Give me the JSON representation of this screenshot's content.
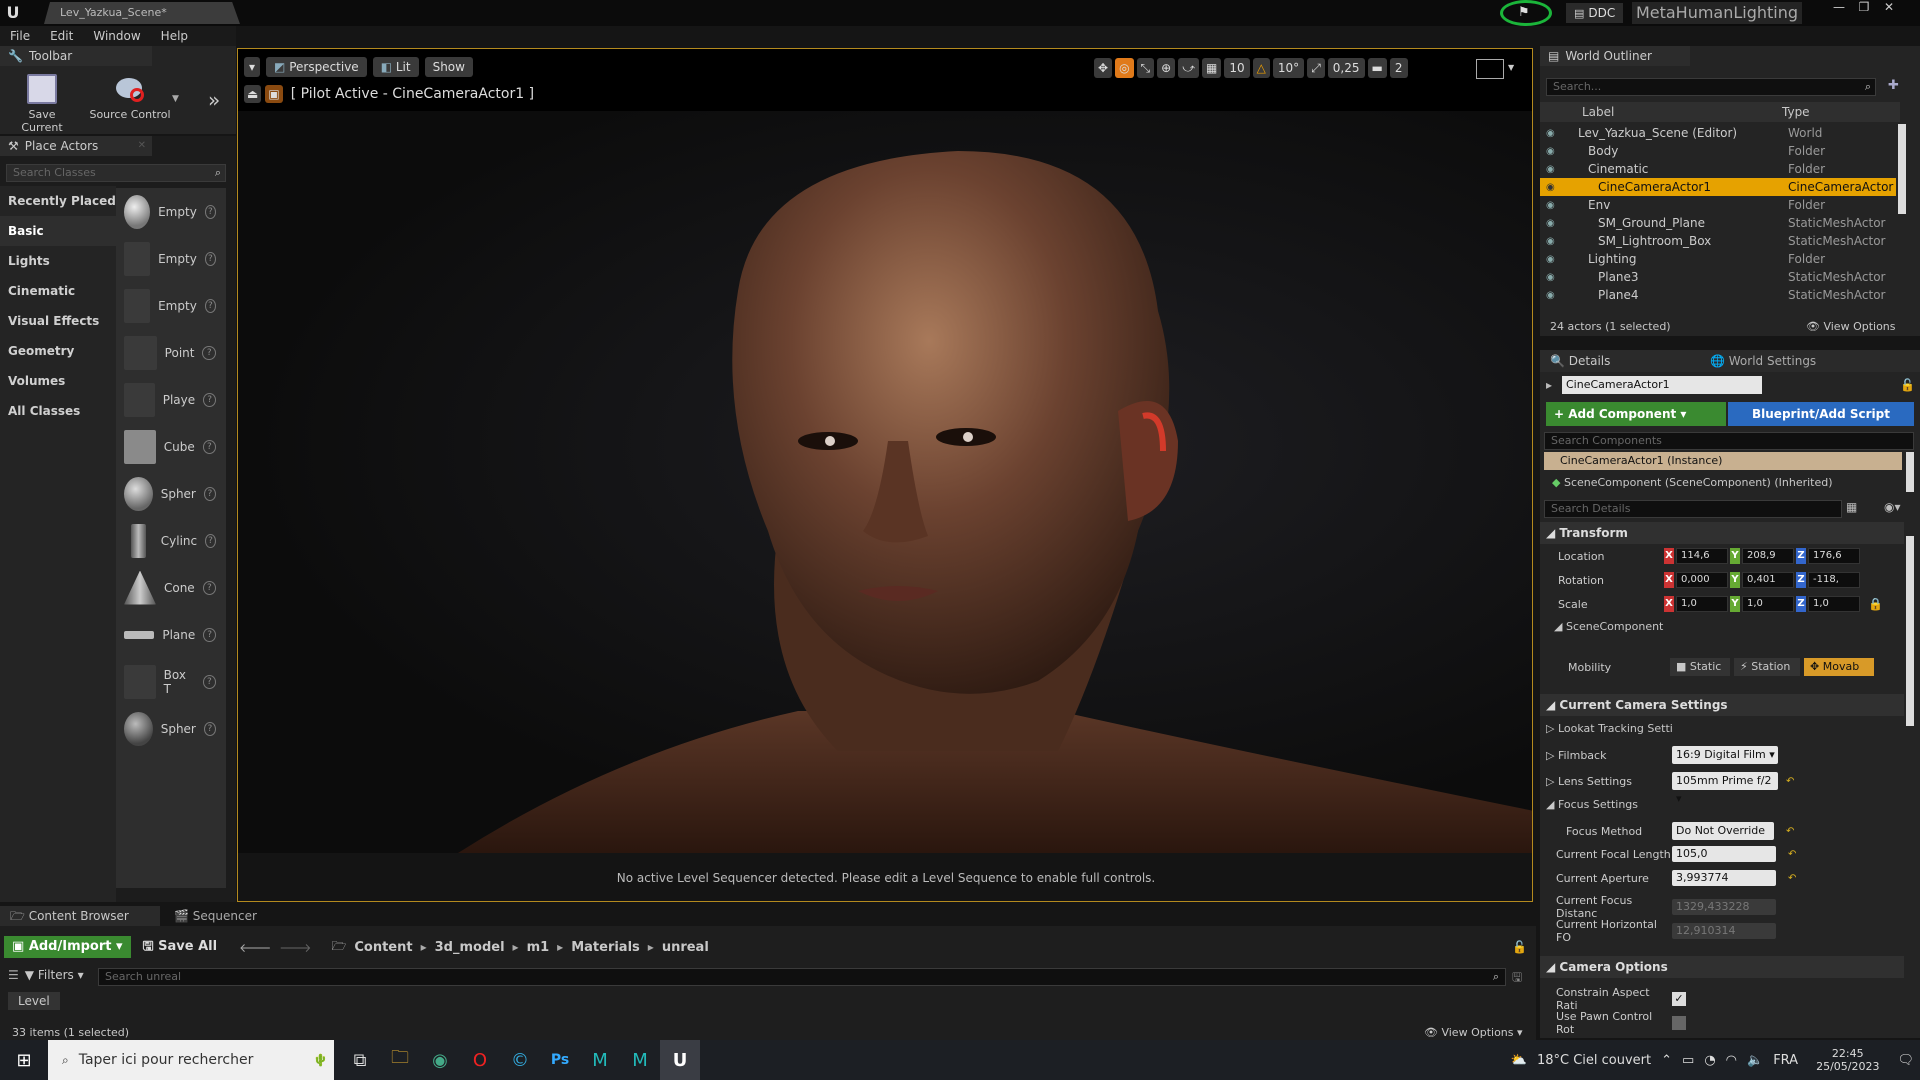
{
  "window": {
    "tab_title": "Lev_Yazkua_Scene*",
    "ddc": "DDC",
    "project": "MetaHumanLighting"
  },
  "menu": [
    "File",
    "Edit",
    "Window",
    "Help"
  ],
  "toolbar": {
    "title": "Toolbar",
    "save_current": "Save Current",
    "source_control": "Source Control"
  },
  "place_actors": {
    "title": "Place Actors",
    "search_placeholder": "Search Classes",
    "categories": [
      "Recently Placed",
      "Basic",
      "Lights",
      "Cinematic",
      "Visual Effects",
      "Geometry",
      "Volumes",
      "All Classes"
    ],
    "items": [
      "Empty",
      "Empty",
      "Empty",
      "Point",
      "Playe",
      "Cube",
      "Spher",
      "Cylinc",
      "Cone",
      "Plane",
      "Box T",
      "Spher"
    ]
  },
  "viewport": {
    "perspective": "Perspective",
    "lit": "Lit",
    "show": "Show",
    "pilot": "[ Pilot Active - CineCameraActor1 ]",
    "grid_snap": "10",
    "rot_snap": "10°",
    "scale_snap": "0,25",
    "cam_speed": "2",
    "message": "No active Level Sequencer detected. Please edit a Level Sequence to enable full controls."
  },
  "outliner": {
    "title": "World Outliner",
    "search_placeholder": "Search...",
    "col_label": "Label",
    "col_type": "Type",
    "rows": [
      {
        "label": "Lev_Yazkua_Scene (Editor)",
        "type": "World"
      },
      {
        "label": "Body",
        "type": "Folder"
      },
      {
        "label": "Cinematic",
        "type": "Folder"
      },
      {
        "label": "CineCameraActor1",
        "type": "CineCameraActor"
      },
      {
        "label": "Env",
        "type": "Folder"
      },
      {
        "label": "SM_Ground_Plane",
        "type": "StaticMeshActor"
      },
      {
        "label": "SM_Lightroom_Box",
        "type": "StaticMeshActor"
      },
      {
        "label": "Lighting",
        "type": "Folder"
      },
      {
        "label": "Plane3",
        "type": "StaticMeshActor"
      },
      {
        "label": "Plane4",
        "type": "StaticMeshActor"
      }
    ],
    "status": "24 actors (1 selected)",
    "view_options": "View Options"
  },
  "details": {
    "tab_details": "Details",
    "tab_world": "World Settings",
    "actor_name": "CineCameraActor1",
    "add_component": "+ Add Component",
    "blueprint": "Blueprint/Add Script",
    "search_components": "Search Components",
    "instance": "CineCameraActor1 (Instance)",
    "scene_component": "SceneComponent (SceneComponent) (Inherited)",
    "search_details": "Search Details",
    "transform": "Transform",
    "location": {
      "label": "Location",
      "x": "114,6",
      "y": "208,9",
      "z": "176,6"
    },
    "rotation": {
      "label": "Rotation",
      "x": "0,000",
      "y": "0,401",
      "z": "-118,"
    },
    "scale": {
      "label": "Scale",
      "x": "1,0",
      "y": "1,0",
      "z": "1,0"
    },
    "scene_component_sect": "SceneComponent",
    "mobility": {
      "label": "Mobility",
      "static": "Static",
      "stationary": "Station",
      "movable": "Movab"
    },
    "camera_settings": "Current Camera Settings",
    "lookat": "Lookat Tracking Setti",
    "filmback": {
      "label": "Filmback",
      "value": "16:9 Digital Film"
    },
    "lens": {
      "label": "Lens Settings",
      "value": "105mm Prime f/2"
    },
    "focus_settings": "Focus Settings",
    "focus_method": {
      "label": "Focus Method",
      "value": "Do Not Override"
    },
    "focal_length": {
      "label": "Current Focal Length",
      "value": "105,0"
    },
    "aperture": {
      "label": "Current Aperture",
      "value": "3,993774"
    },
    "focus_distance": {
      "label": "Current Focus Distanc",
      "value": "1329,433228"
    },
    "horizontal_fov": {
      "label": "Current Horizontal FO",
      "value": "12,910314"
    },
    "camera_options": "Camera Options",
    "constrain": "Constrain Aspect Rati",
    "use_pawn": "Use Pawn Control Rot"
  },
  "content_browser": {
    "tab_content": "Content Browser",
    "tab_sequencer": "Sequencer",
    "add_import": "Add/Import",
    "save_all": "Save All",
    "path": [
      "Content",
      "3d_model",
      "m1",
      "Materials",
      "unreal"
    ],
    "filters": "Filters",
    "search_placeholder": "Search unreal",
    "level_chip": "Level",
    "status": "33 items (1 selected)",
    "view_options": "View Options"
  },
  "taskbar": {
    "search_placeholder": "Taper ici pour rechercher",
    "weather": "18°C Ciel couvert",
    "lang": "FRA",
    "time": "22:45",
    "date": "25/05/2023"
  }
}
